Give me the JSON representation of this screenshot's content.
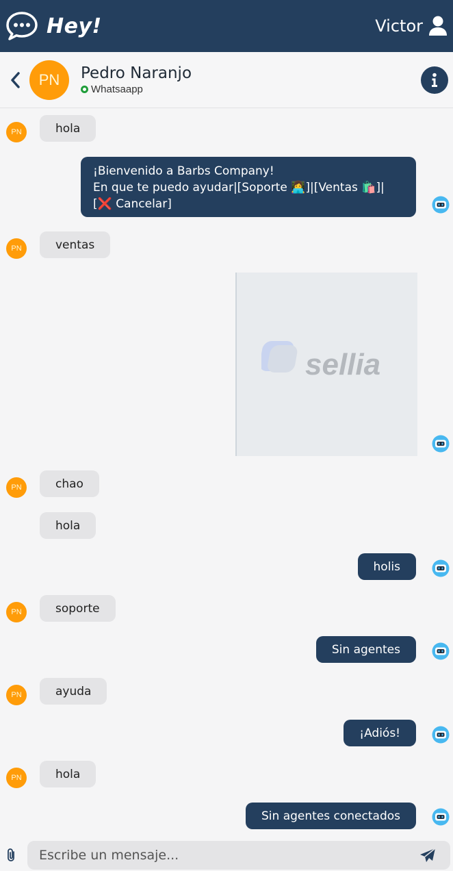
{
  "header": {
    "brand": "Hey!",
    "user": "Victor"
  },
  "contact": {
    "initials": "PN",
    "name": "Pedro Naranjo",
    "channel": "Whatsaapp"
  },
  "messages": {
    "m1": "hola",
    "m2_line1": "¡Bienvenido a Barbs Company!",
    "m2_line2": "En que te puedo ayudar|[Soporte 👩‍💻]|[Ventas 🛍️]|",
    "m2_line3": "[❌ Cancelar]",
    "m3": "ventas",
    "m4_image_brand": "sellia",
    "m5": "chao",
    "m6": "hola",
    "m7": "holis",
    "m8": "soporte",
    "m9": "Sin agentes",
    "m10": "ayuda",
    "m11": "¡Adiós!",
    "m12": "hola",
    "m13": "Sin agentes conectados"
  },
  "composer": {
    "placeholder": "Escribe un mensaje..."
  },
  "colors": {
    "header_bg": "#243f5e",
    "avatar": "#ff9c09",
    "bubble_out": "#243f5e",
    "bubble_in": "#e4e4e6",
    "online": "#1f9d3a"
  }
}
